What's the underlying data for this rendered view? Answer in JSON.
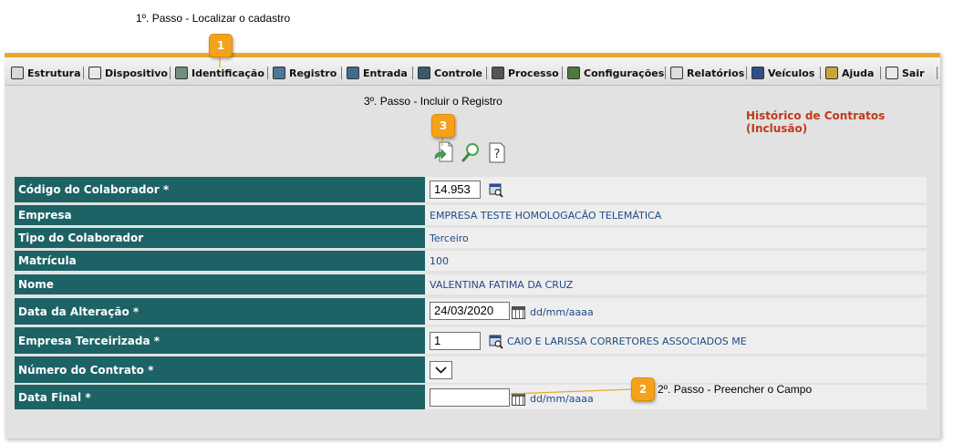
{
  "annotations": {
    "step1": "1º. Passo - Localizar o cadastro",
    "step2": "2º. Passo - Preencher o Campo",
    "step3": "3º. Passo - Incluir o Registro",
    "badge1": "1",
    "badge2": "2",
    "badge3": "3"
  },
  "menu": [
    "Estrutura",
    "Dispositivo",
    "Identificação",
    "Registro",
    "Entrada",
    "Controle",
    "Processo",
    "Configurações",
    "Relatórios",
    "Veículos",
    "Ajuda",
    "Sair"
  ],
  "panel": {
    "title": "Histórico de Contratos (Inclusão)"
  },
  "toolbar": {
    "icons": [
      "new-record-icon",
      "search-icon",
      "help-icon"
    ]
  },
  "form": {
    "codigo": {
      "label": "Código do Colaborador *",
      "value": "14.953"
    },
    "empresa": {
      "label": "Empresa",
      "value": "EMPRESA TESTE HOMOLOGACÂO TELEMÁTICA"
    },
    "tipo": {
      "label": "Tipo do Colaborador",
      "value": "Terceiro"
    },
    "matricula": {
      "label": "Matrícula",
      "value": "100"
    },
    "nome": {
      "label": "Nome",
      "value": "VALENTINA FATIMA DA CRUZ"
    },
    "data_alteracao": {
      "label": "Data da Alteração *",
      "value": "24/03/2020",
      "format": "dd/mm/aaaa"
    },
    "empresa_terceirizada": {
      "label": "Empresa Terceirizada *",
      "value": "1",
      "name": "CAIO E LARISSA CORRETORES ASSOCIADOS ME"
    },
    "numero_contrato": {
      "label": "Número do Contrato *",
      "value": ""
    },
    "data_final": {
      "label": "Data Final *",
      "value": "",
      "format": "dd/mm/aaaa"
    }
  },
  "colors": {
    "accent": "#e8a92a",
    "label_bg": "#1d6366",
    "title": "#c0391b",
    "badge": "#f4a11c"
  }
}
